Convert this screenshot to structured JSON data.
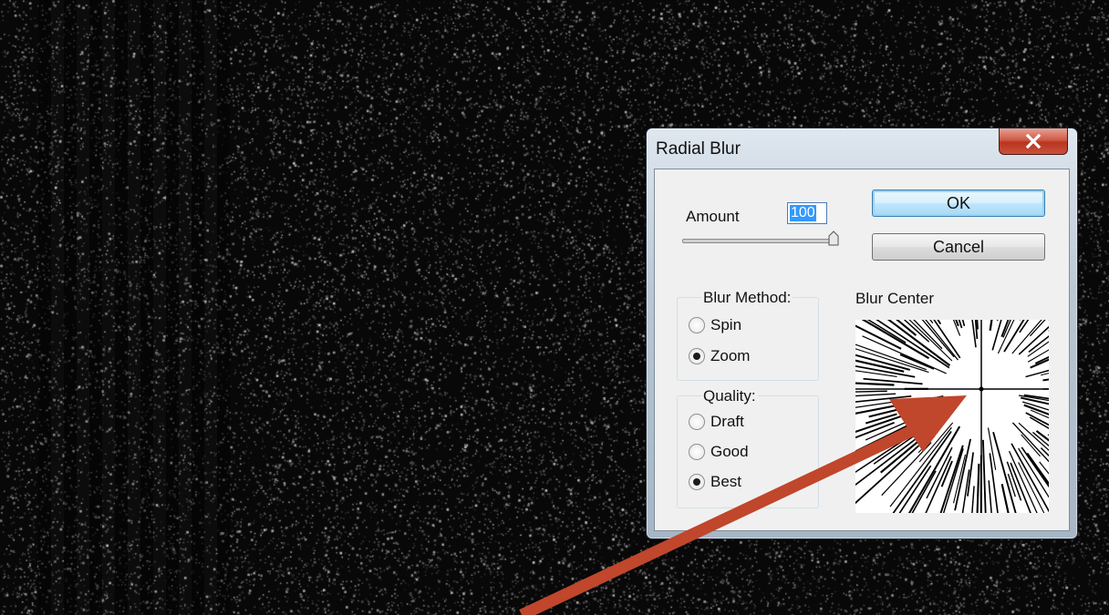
{
  "dialog": {
    "title": "Radial Blur",
    "close_icon": "close-icon",
    "amount_label": "Amount",
    "amount_value": "100",
    "amount_level": 1.0,
    "ok_label": "OK",
    "cancel_label": "Cancel",
    "blur_method": {
      "title": "Blur Method:",
      "options": [
        {
          "label": "Spin",
          "selected": false
        },
        {
          "label": "Zoom",
          "selected": true
        }
      ]
    },
    "quality": {
      "title": "Quality:",
      "options": [
        {
          "label": "Draft",
          "selected": false
        },
        {
          "label": "Good",
          "selected": false
        },
        {
          "label": "Best",
          "selected": true
        }
      ]
    },
    "blur_center_label": "Blur Center"
  },
  "annotation": {
    "color": "#c0462c",
    "icon": "arrow-annotation"
  },
  "colors": {
    "accent": "#3399ff",
    "close": "#c9523c"
  }
}
